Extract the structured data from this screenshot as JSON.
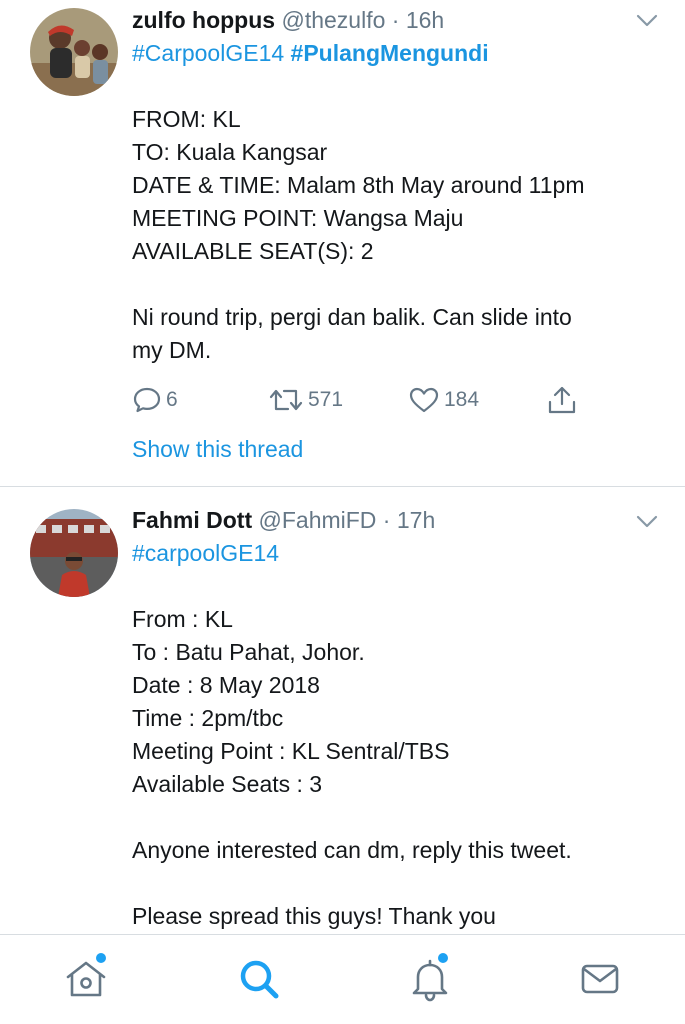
{
  "tweets": [
    {
      "name": "zulfo hoppus",
      "handle": "@thezulfo",
      "separator": " · ",
      "time": "16h",
      "hashtag_1": "#CarpoolGE14",
      "hashtag_2": "#PulangMengundi",
      "lines": [
        "FROM: KL",
        "TO: Kuala Kangsar",
        "DATE & TIME: Malam 8th May around 11pm",
        "MEETING POINT: Wangsa Maju",
        "AVAILABLE SEAT(S): 2",
        "",
        "Ni round trip, pergi dan balik. Can slide into",
        "my DM."
      ],
      "replies": "6",
      "retweets": "571",
      "likes": "184",
      "thread_link": "Show this thread"
    },
    {
      "name": "Fahmi Dott",
      "handle": "@FahmiFD",
      "separator": " · ",
      "time": "17h",
      "hashtag_1": "#carpoolGE14",
      "lines": [
        "From : KL",
        "To : Batu Pahat, Johor.",
        "Date : 8 May 2018",
        "Time : 2pm/tbc",
        "Meeting Point : KL Sentral/TBS",
        "Available Seats : 3",
        "",
        "Anyone interested can dm, reply this tweet.",
        "",
        "Please spread this guys! Thank you"
      ]
    }
  ],
  "tabbar": {
    "items": [
      "home-icon",
      "search-icon",
      "notifications-icon",
      "messages-icon"
    ],
    "active": "search-icon"
  },
  "colors": {
    "accent": "#1da1f2",
    "link": "#1b95e0",
    "muted": "#657786",
    "text": "#14171a",
    "border": "#d8dde1"
  }
}
